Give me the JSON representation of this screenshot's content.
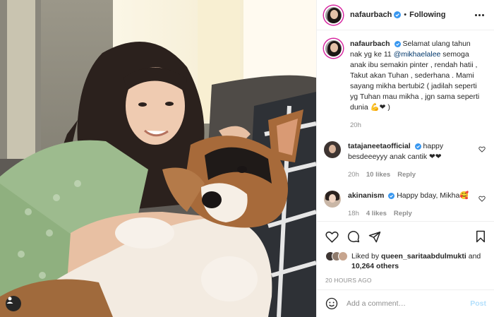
{
  "post": {
    "author": "nafaurbach",
    "follow_state": "Following",
    "dot": "•",
    "caption": {
      "username": "nafaurbach",
      "text_before": " Selamat ulang tahun nak yg ke 11 ",
      "mention": "@mikhaelalee",
      "text_after": " semoga anak ibu semakin pinter , rendah hatii , Takut akan Tuhan , sederhana . Mami sayang mikha bertubi2 ( jadilah seperti yg Tuhan mau mikha , jgn sama seperti dunia 💪❤ )",
      "time": "20h"
    },
    "comments": [
      {
        "username": "tatajaneetaofficial",
        "text": " happy besdeeeyyy anak cantik ❤❤",
        "time": "20h",
        "likes": "10 likes",
        "reply": "Reply"
      },
      {
        "username": "akinanism",
        "text": " Happy bday, Mikha🥰",
        "time": "18h",
        "likes": "4 likes",
        "reply": "Reply"
      }
    ],
    "liked_by": {
      "prefix": "Liked by ",
      "user": "queen_saritaabdulmukti",
      "and": " and",
      "others": "10,264 others"
    },
    "posted_ago": "20 HOURS AGO",
    "add_comment_placeholder": "Add a comment…",
    "post_label": "Post",
    "icons": {
      "like": "heart-icon",
      "comment": "comment-icon",
      "share": "share-icon",
      "save": "bookmark-icon",
      "emoji": "emoji-icon",
      "tag": "user-tag-icon",
      "more": "more-options-icon"
    },
    "colors": {
      "verified": "#3897f0",
      "mention": "#00376b",
      "post_disabled": "#b2dffc",
      "ring": "#d6249f"
    }
  }
}
